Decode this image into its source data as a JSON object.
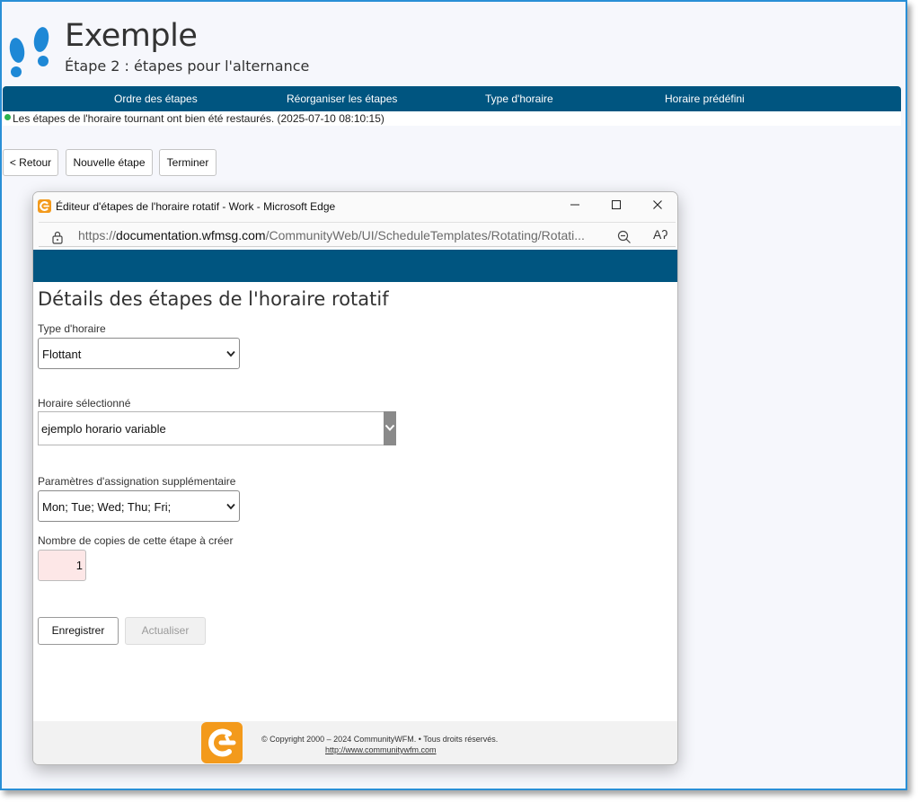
{
  "header": {
    "title": "Exemple",
    "subtitle": "Étape 2 : étapes pour l'alternance"
  },
  "nav": {
    "items": [
      {
        "label": "Ordre des étapes"
      },
      {
        "label": "Réorganiser les étapes"
      },
      {
        "label": "Type d'horaire"
      },
      {
        "label": "Horaire prédéfini"
      }
    ]
  },
  "status": {
    "message": "Les étapes de l'horaire tournant ont bien été restaurés. (2025-07-10 08:10:15)",
    "color": "#2bb24c"
  },
  "actions": {
    "back_label": "< Retour",
    "new_step_label": "Nouvelle étape",
    "finish_label": "Terminer"
  },
  "popup": {
    "window_title": "Éditeur d'étapes de l'horaire rotatif - Work - Microsoft Edge",
    "url_scheme": "https://",
    "url_domain": "documentation.wfmsg.com",
    "url_path": "/CommunityWeb/UI/ScheduleTemplates/Rotating/Rotati...",
    "read_aloud_glyph": "Aʔ",
    "content_title": "Détails des étapes de l'horaire rotatif",
    "schedule_type": {
      "label": "Type d'horaire",
      "value": "Flottant"
    },
    "selected_schedule": {
      "label": "Horaire sélectionné",
      "value": "ejemplo horario variable"
    },
    "extra_params": {
      "label": "Paramètres d'assignation supplémentaire",
      "value": "Mon; Tue; Wed; Thu; Fri;"
    },
    "copies": {
      "label": "Nombre de copies de cette étape à créer",
      "value": "1"
    },
    "save_label": "Enregistrer",
    "update_label": "Actualiser",
    "footer": {
      "copyright": "© Copyright 2000 – 2024 CommunityWFM. • Tous droits réservés.",
      "link": "http://www.communitywfm.com"
    }
  },
  "colors": {
    "brand_blue": "#005580",
    "brand_orange": "#f39a1c",
    "icon_blue": "#1e88d6",
    "required_field_bg": "#fde7e7"
  }
}
